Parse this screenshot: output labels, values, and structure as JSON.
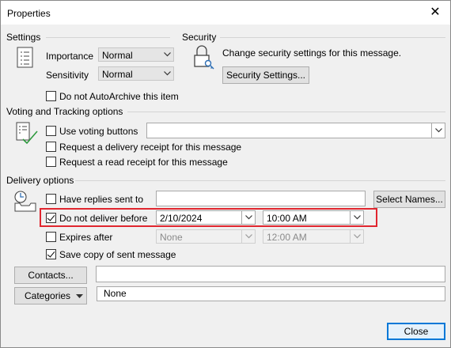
{
  "window": {
    "title": "Properties"
  },
  "settings": {
    "header": "Settings",
    "importance_label": "Importance",
    "importance_value": "Normal",
    "sensitivity_label": "Sensitivity",
    "sensitivity_value": "Normal",
    "autoarchive_label": "Do not AutoArchive this item",
    "autoarchive_checked": false
  },
  "security": {
    "header": "Security",
    "description": "Change security settings for this message.",
    "button_label": "Security Settings..."
  },
  "voting": {
    "header": "Voting and Tracking options",
    "use_voting_label": "Use voting buttons",
    "use_voting_checked": false,
    "use_voting_value": "",
    "delivery_receipt_label": "Request a delivery receipt for this message",
    "read_receipt_label": "Request a read receipt for this message"
  },
  "delivery": {
    "header": "Delivery options",
    "replies_label": "Have replies sent to",
    "replies_value": "",
    "select_names_label": "Select Names...",
    "dnd_label": "Do not deliver before",
    "dnd_checked": true,
    "dnd_date": "2/10/2024",
    "dnd_time": "10:00 AM",
    "expires_label": "Expires after",
    "expires_checked": false,
    "expires_date": "None",
    "expires_time": "12:00 AM",
    "save_copy_label": "Save copy of sent message",
    "save_copy_checked": true
  },
  "contacts": {
    "button_label": "Contacts...",
    "value": ""
  },
  "categories": {
    "button_label": "Categories",
    "value": "None"
  },
  "footer": {
    "close_label": "Close"
  },
  "colors": {
    "highlight": "#e0262f",
    "default_button": "#0078d7"
  }
}
